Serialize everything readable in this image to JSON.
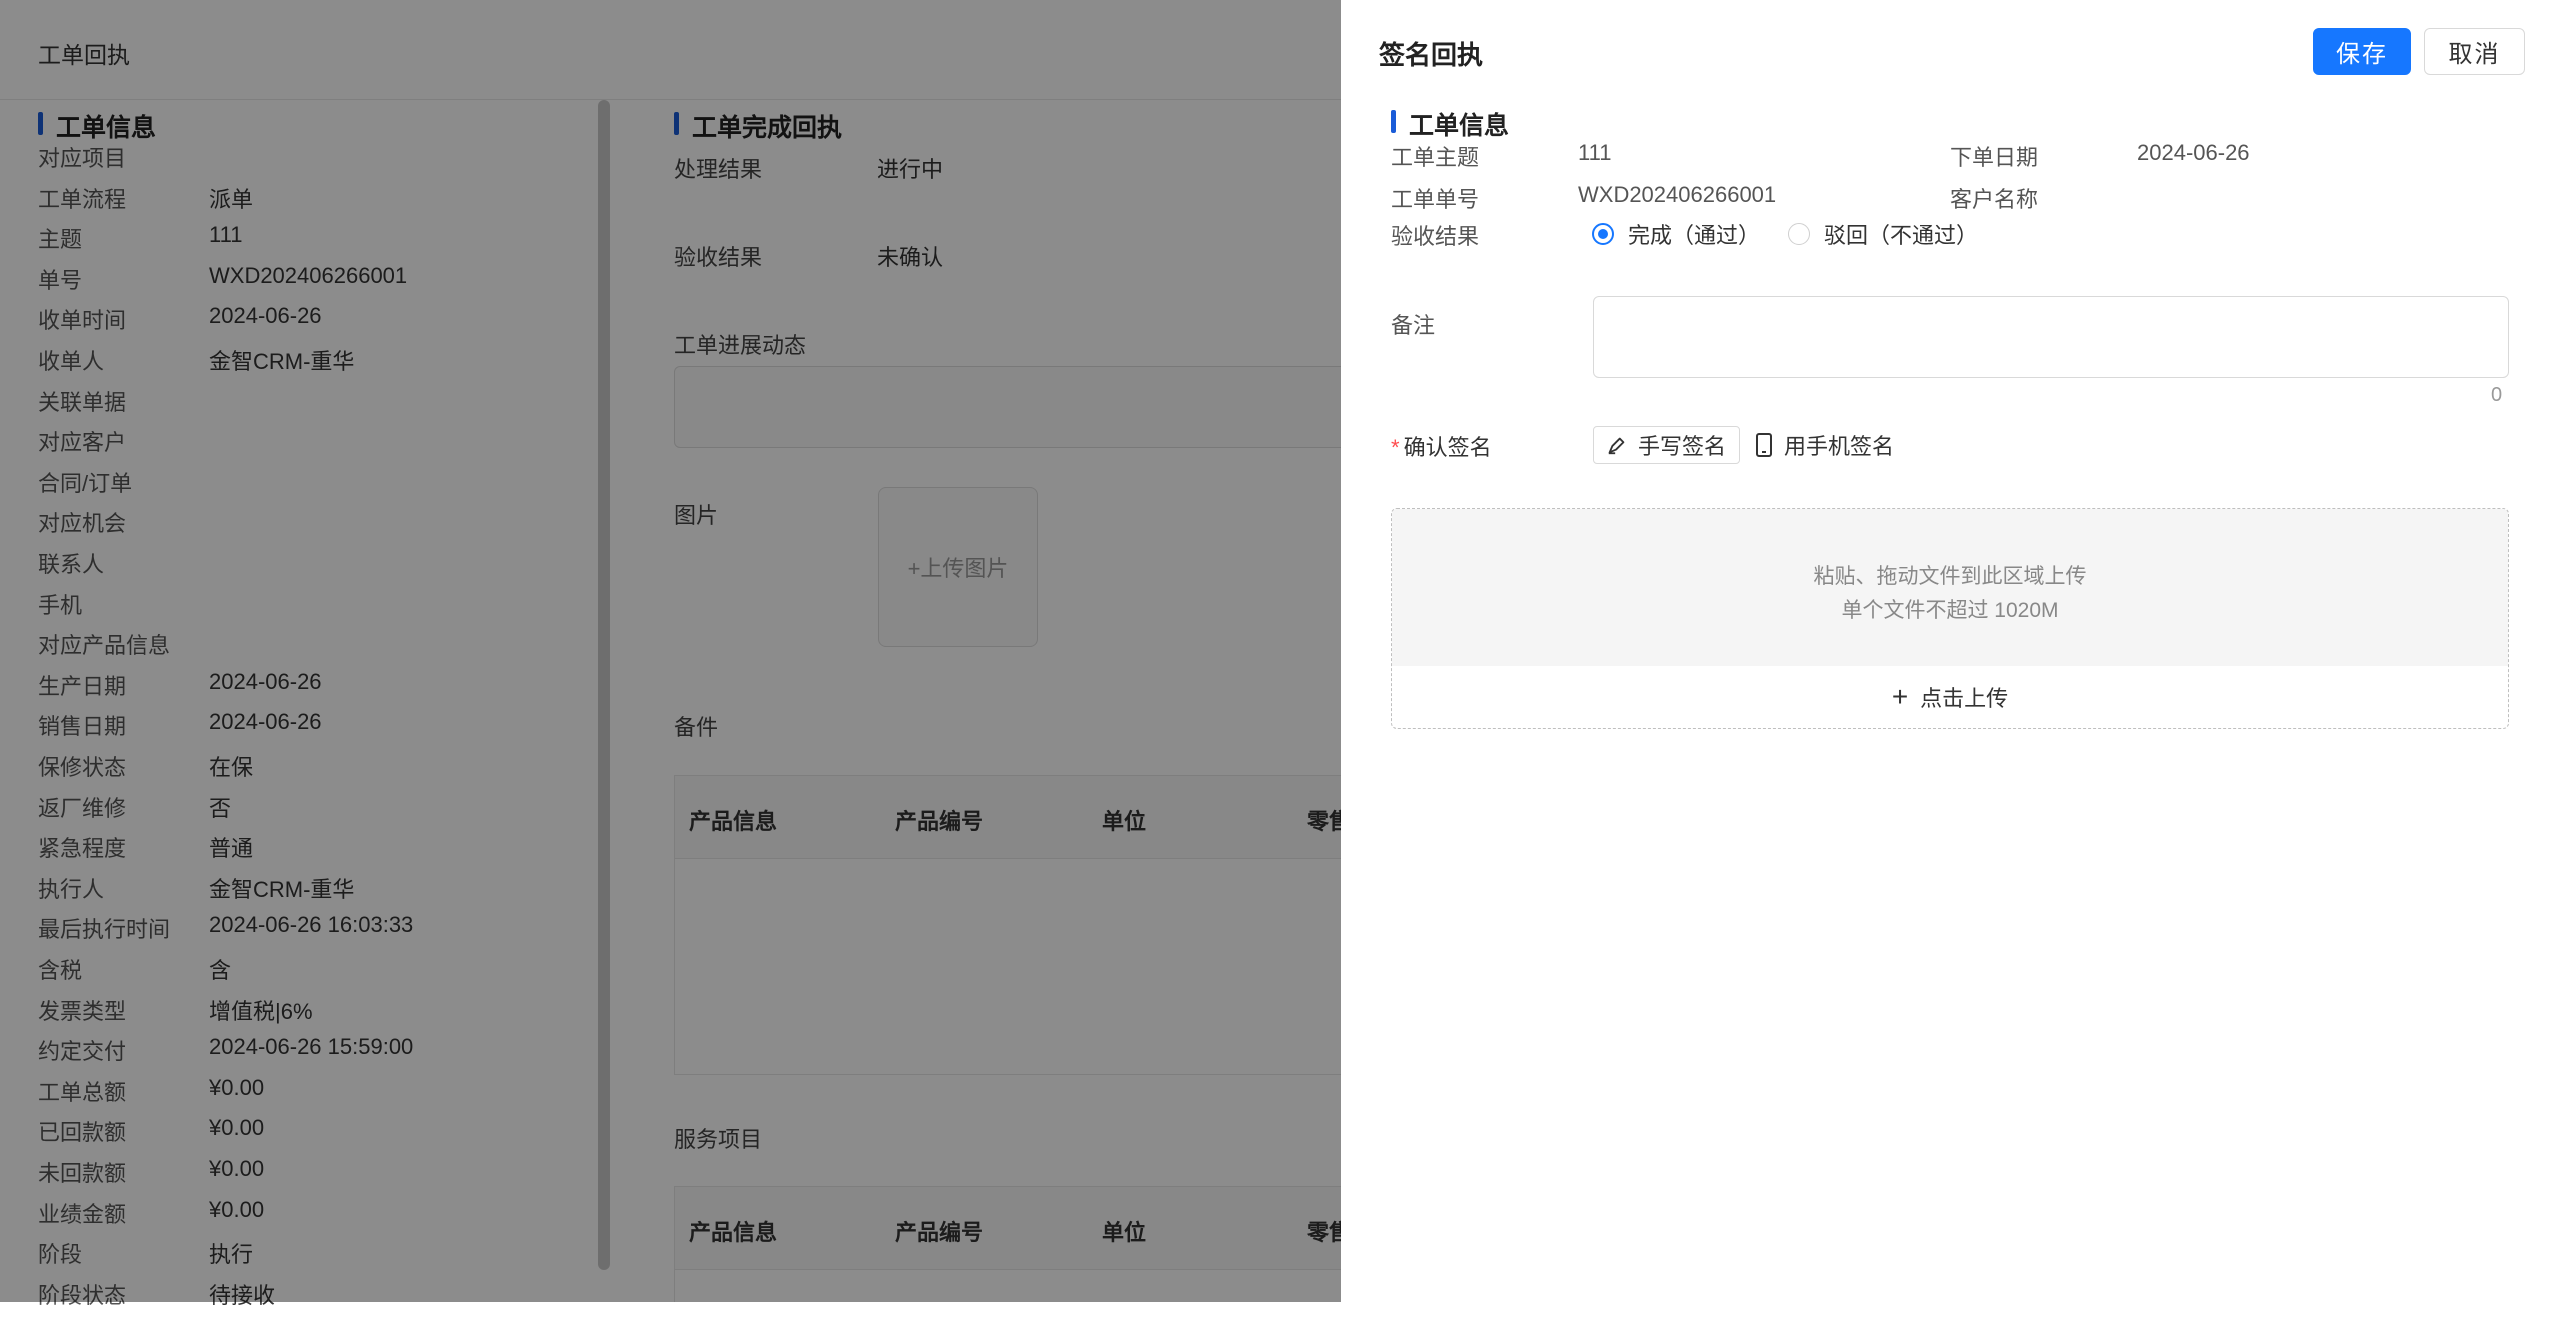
{
  "background": {
    "page_title": "工单回执",
    "info_section_title": "工单信息",
    "info_rows": [
      {
        "label": "对应项目",
        "value": ""
      },
      {
        "label": "工单流程",
        "value": "派单"
      },
      {
        "label": "主题",
        "value": "111"
      },
      {
        "label": "单号",
        "value": "WXD202406266001"
      },
      {
        "label": "收单时间",
        "value": "2024-06-26"
      },
      {
        "label": "收单人",
        "value": "金智CRM-重华"
      },
      {
        "label": "关联单据",
        "value": ""
      },
      {
        "label": "对应客户",
        "value": ""
      },
      {
        "label": "合同/订单",
        "value": ""
      },
      {
        "label": "对应机会",
        "value": ""
      },
      {
        "label": "联系人",
        "value": ""
      },
      {
        "label": "手机",
        "value": ""
      },
      {
        "label": "对应产品信息",
        "value": ""
      },
      {
        "label": "生产日期",
        "value": "2024-06-26"
      },
      {
        "label": "销售日期",
        "value": "2024-06-26"
      },
      {
        "label": "保修状态",
        "value": "在保"
      },
      {
        "label": "返厂维修",
        "value": "否"
      },
      {
        "label": "紧急程度",
        "value": "普通"
      },
      {
        "label": "执行人",
        "value": "金智CRM-重华"
      },
      {
        "label": "最后执行时间",
        "value": "2024-06-26 16:03:33"
      },
      {
        "label": "含税",
        "value": "含"
      },
      {
        "label": "发票类型",
        "value": "增值税|6%"
      },
      {
        "label": "约定交付",
        "value": "2024-06-26 15:59:00"
      },
      {
        "label": "工单总额",
        "value": "¥0.00"
      },
      {
        "label": "已回款额",
        "value": "¥0.00"
      },
      {
        "label": "未回款额",
        "value": "¥0.00"
      },
      {
        "label": "业绩金额",
        "value": "¥0.00"
      },
      {
        "label": "阶段",
        "value": "执行"
      },
      {
        "label": "阶段状态",
        "value": "待接收"
      }
    ],
    "completion_section_title": "工单完成回执",
    "process_result_label": "处理结果",
    "process_result_value": "进行中",
    "acceptance_label": "验收结果",
    "acceptance_value": "未确认",
    "progress_label": "工单进展动态",
    "picture_label": "图片",
    "upload_picture_label": "+上传图片",
    "parts_label": "备件",
    "parts_table_headers": [
      "产品信息",
      "产品编号",
      "单位",
      "零售"
    ],
    "service_label": "服务项目",
    "service_table_headers": [
      "产品信息",
      "产品编号",
      "单位",
      "零售"
    ]
  },
  "drawer": {
    "title": "签名回执",
    "save_label": "保存",
    "cancel_label": "取消",
    "section_title": "工单信息",
    "subject_label": "工单主题",
    "subject_value": "111",
    "order_date_label": "下单日期",
    "order_date_value": "2024-06-26",
    "order_no_label": "工单单号",
    "order_no_value": "WXD202406266001",
    "customer_label": "客户名称",
    "customer_value": "",
    "acceptance_label": "验收结果",
    "radio_options": [
      {
        "label": "完成（通过）",
        "checked": true
      },
      {
        "label": "驳回（不通过）",
        "checked": false
      }
    ],
    "remark_label": "备注",
    "remark_value": "",
    "remark_count": "0",
    "signature_required_mark": "*",
    "signature_label": "确认签名",
    "handwrite_label": "手写签名",
    "phone_sign_label": "用手机签名",
    "upload_hint_line1": "粘贴、拖动文件到此区域上传",
    "upload_hint_line2": "单个文件不超过 1020M",
    "upload_click_label": "点击上传",
    "primary_color": "#1677ff"
  }
}
